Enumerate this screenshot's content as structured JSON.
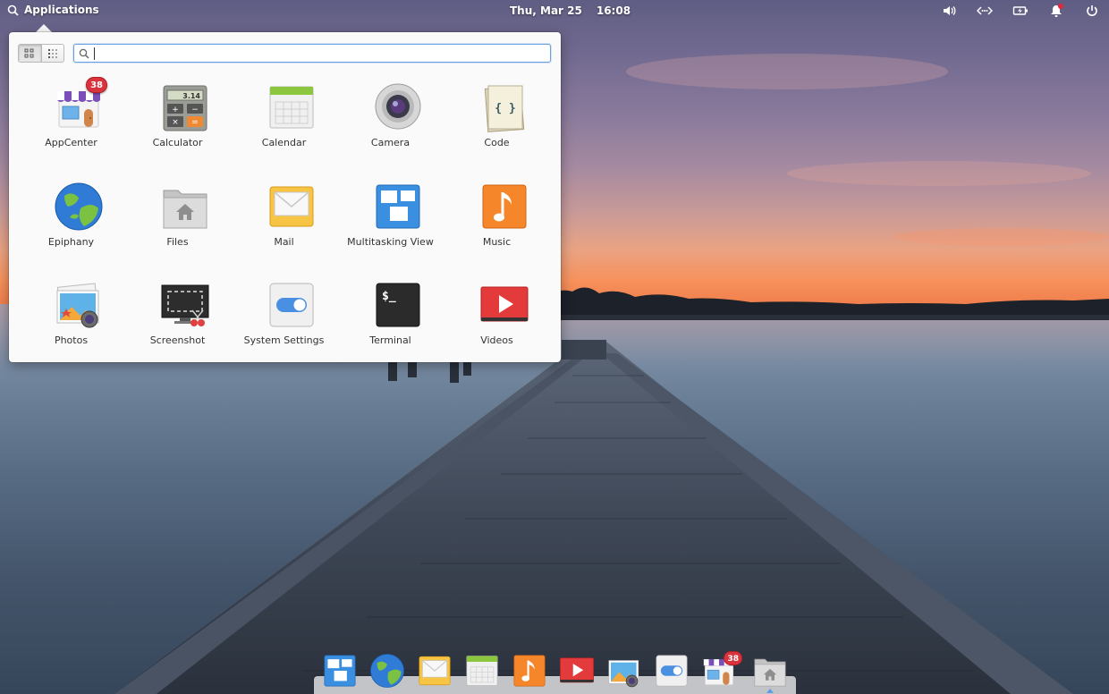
{
  "panel": {
    "applications_label": "Applications",
    "date": "Thu, Mar 25",
    "time": "16:08",
    "indicators": [
      "volume-icon",
      "network-icon",
      "battery-icon",
      "notifications-icon",
      "power-icon"
    ]
  },
  "launcher": {
    "search": {
      "value": "",
      "placeholder": ""
    },
    "view_modes": [
      "grid-view-icon",
      "category-view-icon"
    ],
    "active_view": "grid-view-icon",
    "apps": [
      {
        "label": "AppCenter",
        "icon": "appcenter-icon",
        "badge": "38"
      },
      {
        "label": "Calculator",
        "icon": "calculator-icon",
        "display": "3.14"
      },
      {
        "label": "Calendar",
        "icon": "calendar-icon"
      },
      {
        "label": "Camera",
        "icon": "camera-icon"
      },
      {
        "label": "Code",
        "icon": "code-icon",
        "glyph": "{ }"
      },
      {
        "label": "Epiphany",
        "icon": "epiphany-icon"
      },
      {
        "label": "Files",
        "icon": "files-icon"
      },
      {
        "label": "Mail",
        "icon": "mail-icon"
      },
      {
        "label": "Multitasking View",
        "icon": "multitasking-icon"
      },
      {
        "label": "Music",
        "icon": "music-icon"
      },
      {
        "label": "Photos",
        "icon": "photos-icon"
      },
      {
        "label": "Screenshot",
        "icon": "screenshot-icon"
      },
      {
        "label": "System Settings",
        "icon": "settings-icon"
      },
      {
        "label": "Terminal",
        "icon": "terminal-icon",
        "prompt": "$_"
      },
      {
        "label": "Videos",
        "icon": "videos-icon"
      }
    ]
  },
  "dock": {
    "items": [
      {
        "icon": "multitasking-icon"
      },
      {
        "icon": "epiphany-icon"
      },
      {
        "icon": "mail-icon"
      },
      {
        "icon": "calendar-icon"
      },
      {
        "icon": "music-icon"
      },
      {
        "icon": "videos-icon"
      },
      {
        "icon": "photos-icon"
      },
      {
        "icon": "settings-icon"
      },
      {
        "icon": "appcenter-icon",
        "badge": "38"
      },
      {
        "icon": "files-icon",
        "running": true
      }
    ]
  },
  "colors": {
    "accent": "#5b9ee6",
    "badge": "#d9343e"
  }
}
